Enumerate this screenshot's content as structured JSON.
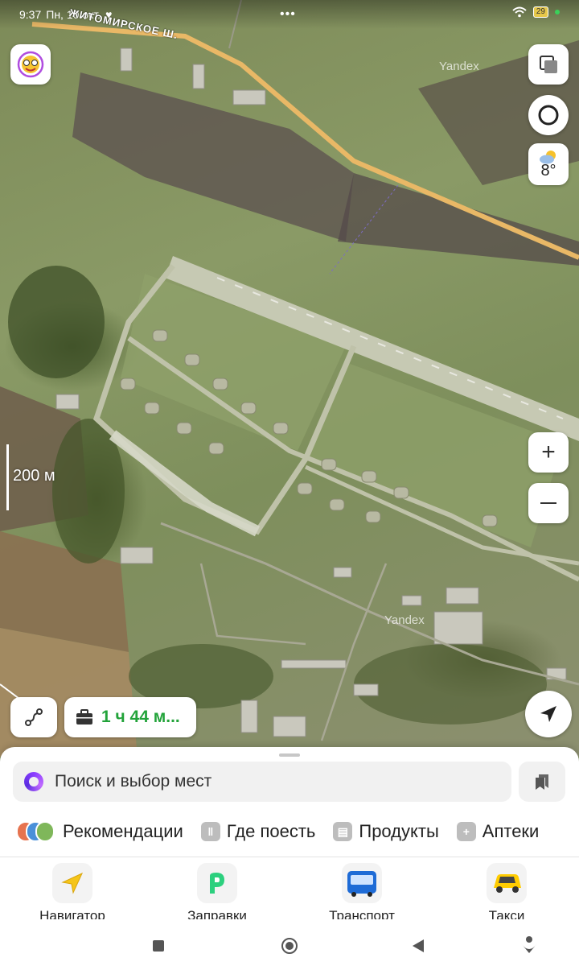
{
  "status_bar": {
    "time": "9:37",
    "date": "Пн, 10 окт.",
    "battery": "29"
  },
  "map": {
    "road_name": "ЖИТОМИРСКОЕ Ш.",
    "watermark": "Yandex",
    "scale_label": "200 м",
    "weather_temp": "8°",
    "route_time": "1 ч 44 м..."
  },
  "search": {
    "placeholder": "Поиск и выбор мест"
  },
  "categories": [
    {
      "label": "Рекомендации",
      "icon": "recommendations-icon"
    },
    {
      "label": "Где поесть",
      "icon": "fork-knife-icon"
    },
    {
      "label": "Продукты",
      "icon": "basket-icon"
    },
    {
      "label": "Аптеки",
      "icon": "plus-cross-icon"
    }
  ],
  "tabs": [
    {
      "label": "Навигатор",
      "icon": "navigator-arrow-icon",
      "color": "#f5c518"
    },
    {
      "label": "Заправки",
      "icon": "gas-station-icon",
      "color": "#2cd07e"
    },
    {
      "label": "Транспорт",
      "icon": "bus-icon",
      "color": "#1e6bd6"
    },
    {
      "label": "Такси",
      "icon": "taxi-car-icon",
      "color": "#ffcc00"
    }
  ],
  "system_nav": [
    "square-icon",
    "circle-icon",
    "back-triangle-icon",
    "assistant-icon"
  ]
}
